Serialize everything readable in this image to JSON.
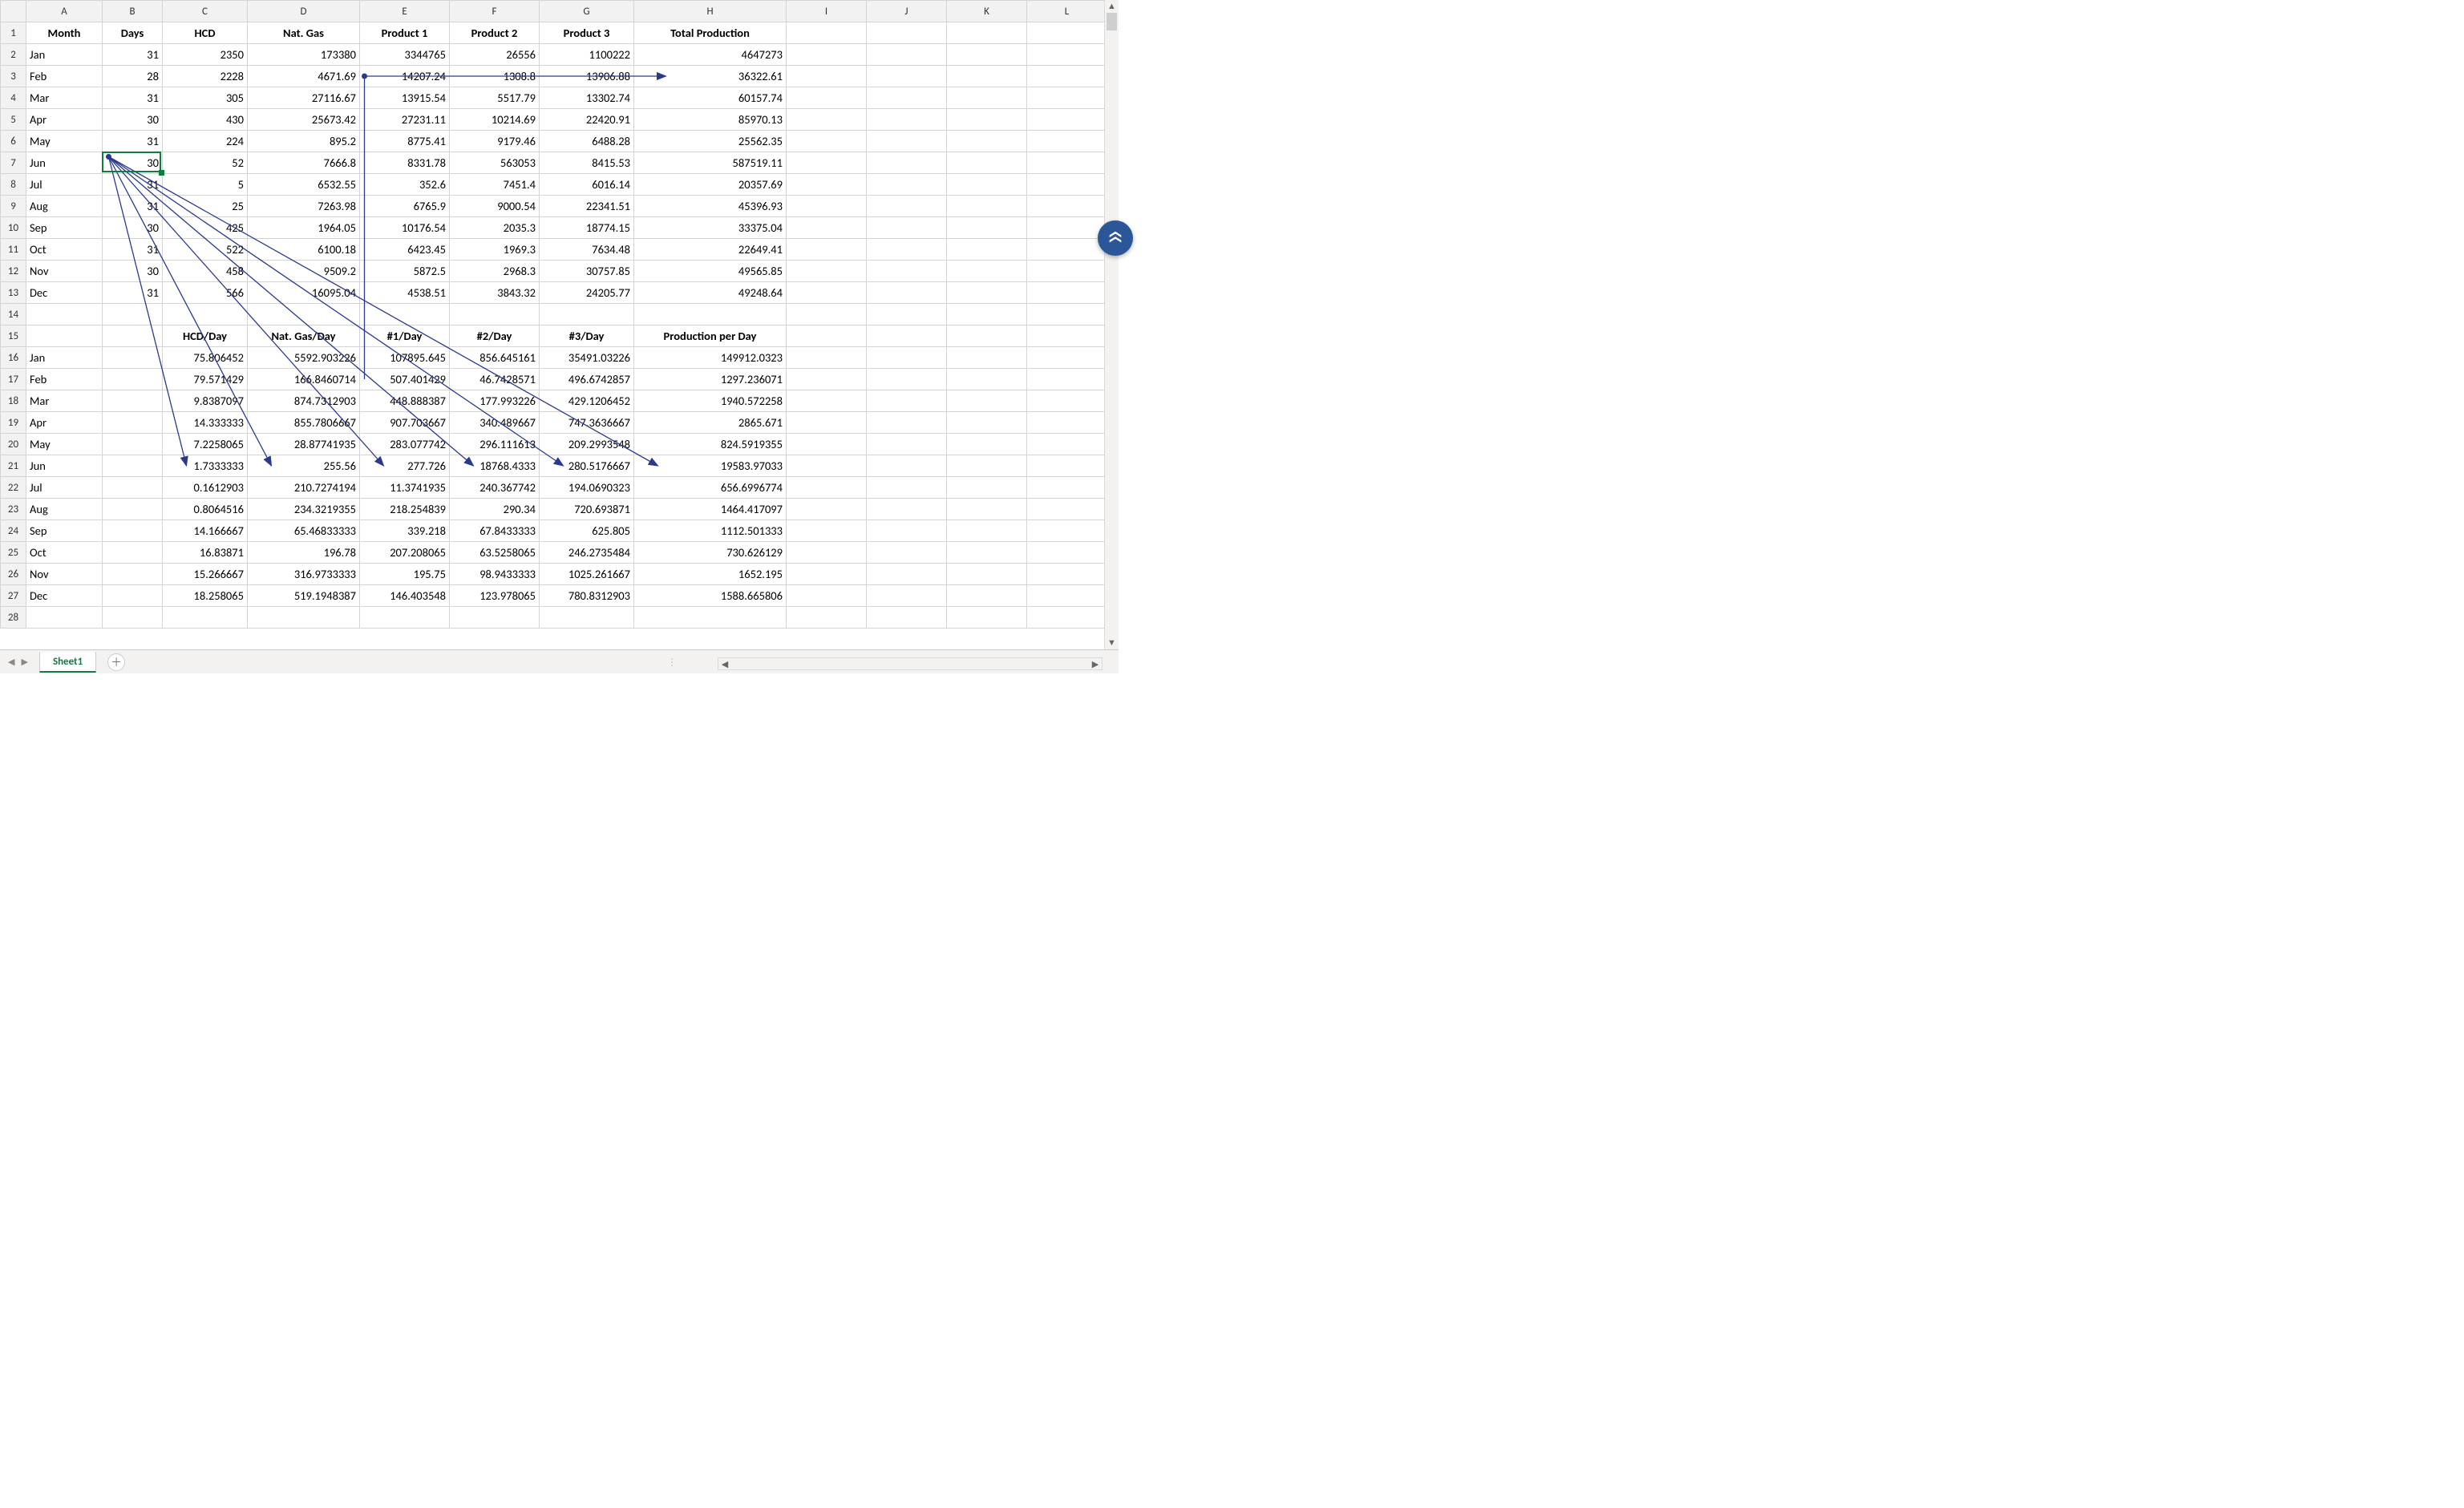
{
  "columns": [
    "A",
    "B",
    "C",
    "D",
    "E",
    "F",
    "G",
    "H",
    "I",
    "J",
    "K",
    "L"
  ],
  "rowCount": 28,
  "selectedCell": "B7",
  "sheetTab": "Sheet1",
  "headers1": {
    "A": "Month",
    "B": "Days",
    "C": "HCD",
    "D": "Nat. Gas",
    "E": "Product 1",
    "F": "Product 2",
    "G": "Product 3",
    "H": "Total Production"
  },
  "rowsTop": [
    {
      "A": "Jan",
      "B": "31",
      "C": "2350",
      "D": "173380",
      "E": "3344765",
      "F": "26556",
      "G": "1100222",
      "H": "4647273"
    },
    {
      "A": "Feb",
      "B": "28",
      "C": "2228",
      "D": "4671.69",
      "E": "14207.24",
      "F": "1308.8",
      "G": "13906.88",
      "H": "36322.61"
    },
    {
      "A": "Mar",
      "B": "31",
      "C": "305",
      "D": "27116.67",
      "E": "13915.54",
      "F": "5517.79",
      "G": "13302.74",
      "H": "60157.74"
    },
    {
      "A": "Apr",
      "B": "30",
      "C": "430",
      "D": "25673.42",
      "E": "27231.11",
      "F": "10214.69",
      "G": "22420.91",
      "H": "85970.13"
    },
    {
      "A": "May",
      "B": "31",
      "C": "224",
      "D": "895.2",
      "E": "8775.41",
      "F": "9179.46",
      "G": "6488.28",
      "H": "25562.35"
    },
    {
      "A": "Jun",
      "B": "30",
      "C": "52",
      "D": "7666.8",
      "E": "8331.78",
      "F": "563053",
      "G": "8415.53",
      "H": "587519.11"
    },
    {
      "A": "Jul",
      "B": "31",
      "C": "5",
      "D": "6532.55",
      "E": "352.6",
      "F": "7451.4",
      "G": "6016.14",
      "H": "20357.69"
    },
    {
      "A": "Aug",
      "B": "31",
      "C": "25",
      "D": "7263.98",
      "E": "6765.9",
      "F": "9000.54",
      "G": "22341.51",
      "H": "45396.93"
    },
    {
      "A": "Sep",
      "B": "30",
      "C": "425",
      "D": "1964.05",
      "E": "10176.54",
      "F": "2035.3",
      "G": "18774.15",
      "H": "33375.04"
    },
    {
      "A": "Oct",
      "B": "31",
      "C": "522",
      "D": "6100.18",
      "E": "6423.45",
      "F": "1969.3",
      "G": "7634.48",
      "H": "22649.41"
    },
    {
      "A": "Nov",
      "B": "30",
      "C": "458",
      "D": "9509.2",
      "E": "5872.5",
      "F": "2968.3",
      "G": "30757.85",
      "H": "49565.85"
    },
    {
      "A": "Dec",
      "B": "31",
      "C": "566",
      "D": "16095.04",
      "E": "4538.51",
      "F": "3843.32",
      "G": "24205.77",
      "H": "49248.64"
    }
  ],
  "headers2": {
    "C": "HCD/Day",
    "D": "Nat. Gas/Day",
    "E": "#1/Day",
    "F": "#2/Day",
    "G": "#3/Day",
    "H": "Production per Day"
  },
  "rowsBottom": [
    {
      "A": "Jan",
      "C": "75.806452",
      "D": "5592.903226",
      "E": "107895.645",
      "F": "856.645161",
      "G": "35491.03226",
      "H": "149912.0323"
    },
    {
      "A": "Feb",
      "C": "79.571429",
      "D": "166.8460714",
      "E": "507.401429",
      "F": "46.7428571",
      "G": "496.6742857",
      "H": "1297.236071"
    },
    {
      "A": "Mar",
      "C": "9.8387097",
      "D": "874.7312903",
      "E": "448.888387",
      "F": "177.993226",
      "G": "429.1206452",
      "H": "1940.572258"
    },
    {
      "A": "Apr",
      "C": "14.333333",
      "D": "855.7806667",
      "E": "907.703667",
      "F": "340.489667",
      "G": "747.3636667",
      "H": "2865.671"
    },
    {
      "A": "May",
      "C": "7.2258065",
      "D": "28.87741935",
      "E": "283.077742",
      "F": "296.111613",
      "G": "209.2993548",
      "H": "824.5919355"
    },
    {
      "A": "Jun",
      "C": "1.7333333",
      "D": "255.56",
      "E": "277.726",
      "F": "18768.4333",
      "G": "280.5176667",
      "H": "19583.97033"
    },
    {
      "A": "Jul",
      "C": "0.1612903",
      "D": "210.7274194",
      "E": "11.3741935",
      "F": "240.367742",
      "G": "194.0690323",
      "H": "656.6996774"
    },
    {
      "A": "Aug",
      "C": "0.8064516",
      "D": "234.3219355",
      "E": "218.254839",
      "F": "290.34",
      "G": "720.693871",
      "H": "1464.417097"
    },
    {
      "A": "Sep",
      "C": "14.166667",
      "D": "65.46833333",
      "E": "339.218",
      "F": "67.8433333",
      "G": "625.805",
      "H": "1112.501333"
    },
    {
      "A": "Oct",
      "C": "16.83871",
      "D": "196.78",
      "E": "207.208065",
      "F": "63.5258065",
      "G": "246.2735484",
      "H": "730.626129"
    },
    {
      "A": "Nov",
      "C": "15.266667",
      "D": "316.9733333",
      "E": "195.75",
      "F": "98.9433333",
      "G": "1025.261667",
      "H": "1652.195"
    },
    {
      "A": "Dec",
      "C": "18.258065",
      "D": "519.1948387",
      "E": "146.403548",
      "F": "123.978065",
      "G": "780.8312903",
      "H": "1588.665806"
    }
  ],
  "tracerArrows": {
    "description": "Formula trace arrows. Horizontal precedent arrow across row 3 (E3→H3). Fan of dependent arrows from selected B7 down to row 21 cells C21–H21, plus vertical E3→E17.",
    "origin": "B7"
  }
}
